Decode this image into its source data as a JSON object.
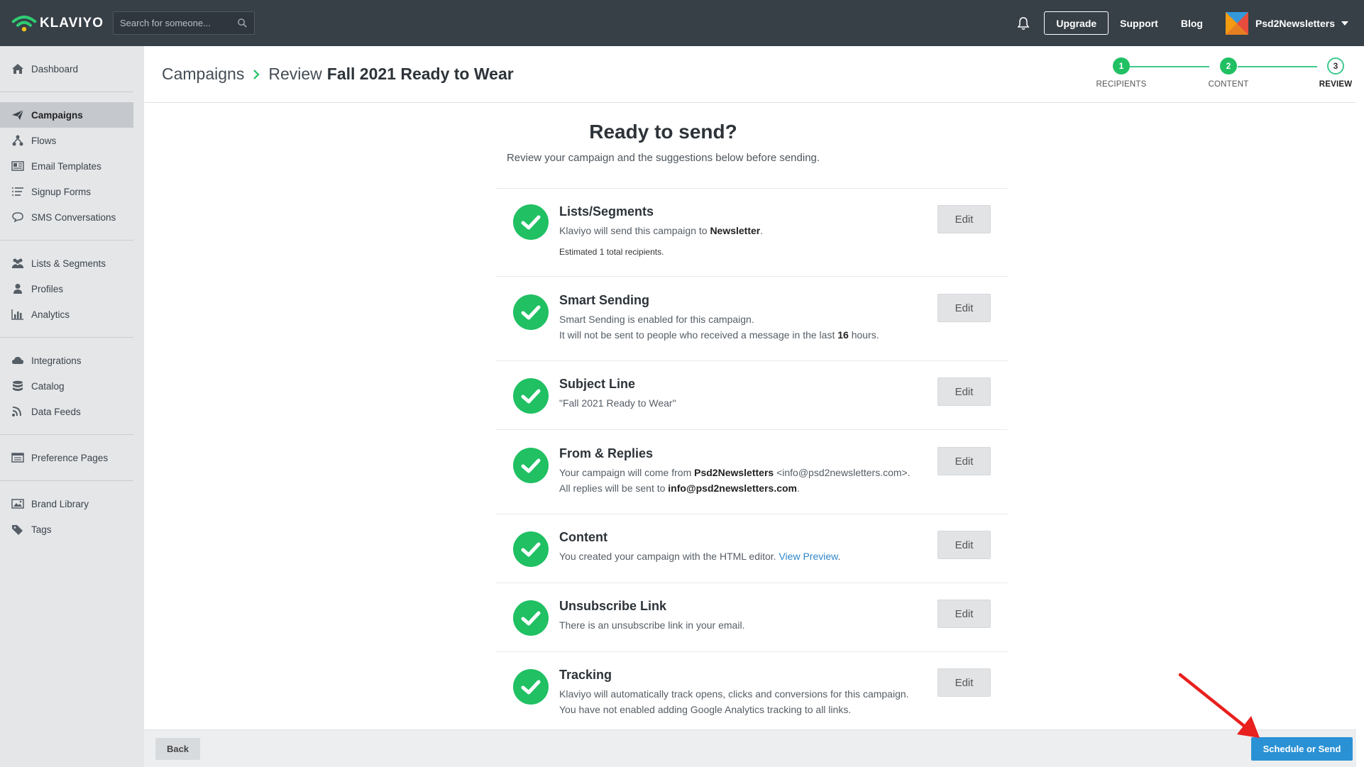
{
  "app": {
    "brand": "KLAVIYO",
    "search": {
      "placeholder": "Search for someone..."
    },
    "top_nav": {
      "upgrade": "Upgrade",
      "support": "Support",
      "blog": "Blog",
      "account": "Psd2Newsletters"
    }
  },
  "sidebar": {
    "groups": [
      [
        {
          "label": "Dashboard",
          "icon": "home-icon"
        }
      ],
      [
        {
          "label": "Campaigns",
          "icon": "paper-plane-icon",
          "active": true
        },
        {
          "label": "Flows",
          "icon": "flows-icon"
        },
        {
          "label": "Email Templates",
          "icon": "template-icon"
        },
        {
          "label": "Signup Forms",
          "icon": "form-list-icon"
        },
        {
          "label": "SMS Conversations",
          "icon": "chat-icon"
        }
      ],
      [
        {
          "label": "Lists & Segments",
          "icon": "users-icon"
        },
        {
          "label": "Profiles",
          "icon": "user-icon"
        },
        {
          "label": "Analytics",
          "icon": "bar-chart-icon"
        }
      ],
      [
        {
          "label": "Integrations",
          "icon": "cloud-icon"
        },
        {
          "label": "Catalog",
          "icon": "database-icon"
        },
        {
          "label": "Data Feeds",
          "icon": "rss-icon"
        }
      ],
      [
        {
          "label": "Preference Pages",
          "icon": "preference-icon"
        }
      ],
      [
        {
          "label": "Brand Library",
          "icon": "image-icon"
        },
        {
          "label": "Tags",
          "icon": "tag-icon"
        }
      ]
    ]
  },
  "header": {
    "breadcrumb_root": "Campaigns",
    "breadcrumb_prefix": "Review",
    "campaign_name": "Fall 2021 Ready to Wear",
    "steps": [
      {
        "number": "1",
        "label": "RECIPIENTS",
        "state": "done"
      },
      {
        "number": "2",
        "label": "CONTENT",
        "state": "done"
      },
      {
        "number": "3",
        "label": "REVIEW",
        "state": "current"
      }
    ]
  },
  "review": {
    "title": "Ready to send?",
    "subtitle": "Review your campaign and the suggestions below before sending.",
    "edit_label": "Edit",
    "items": {
      "lists": {
        "title": "Lists/Segments",
        "line1_pre": "Klaviyo will send this campaign to ",
        "line1_bold": "Newsletter",
        "line1_post": ".",
        "small": "Estimated 1 total recipients."
      },
      "smart": {
        "title": "Smart Sending",
        "line1": "Smart Sending is enabled for this campaign.",
        "line2_pre": "It will not be sent to people who received a message in the last ",
        "line2_bold": "16",
        "line2_post": " hours."
      },
      "subject": {
        "title": "Subject Line",
        "line1": "\"Fall 2021 Ready to Wear\""
      },
      "from": {
        "title": "From & Replies",
        "line1_pre": "Your campaign will come from ",
        "line1_bold": "Psd2Newsletters",
        "line1_post": " <info@psd2newsletters.com>.",
        "line2_pre": "All replies will be sent to ",
        "line2_bold": "info@psd2newsletters.com",
        "line2_post": "."
      },
      "content": {
        "title": "Content",
        "line1_pre": "You created your campaign with the HTML editor. ",
        "link": "View Preview",
        "line1_post": "."
      },
      "unsubscribe": {
        "title": "Unsubscribe Link",
        "line1": "There is an unsubscribe link in your email."
      },
      "tracking": {
        "title": "Tracking",
        "line1": "Klaviyo will automatically track opens, clicks and conversions for this campaign.",
        "line2": "You have not enabled adding Google Analytics tracking to all links."
      }
    }
  },
  "footer": {
    "back": "Back",
    "send": "Schedule or Send"
  },
  "colors": {
    "topbar": "#373f47",
    "success": "#20c063",
    "primary": "#2a91d5",
    "annotation_arrow": "#e8201e"
  }
}
